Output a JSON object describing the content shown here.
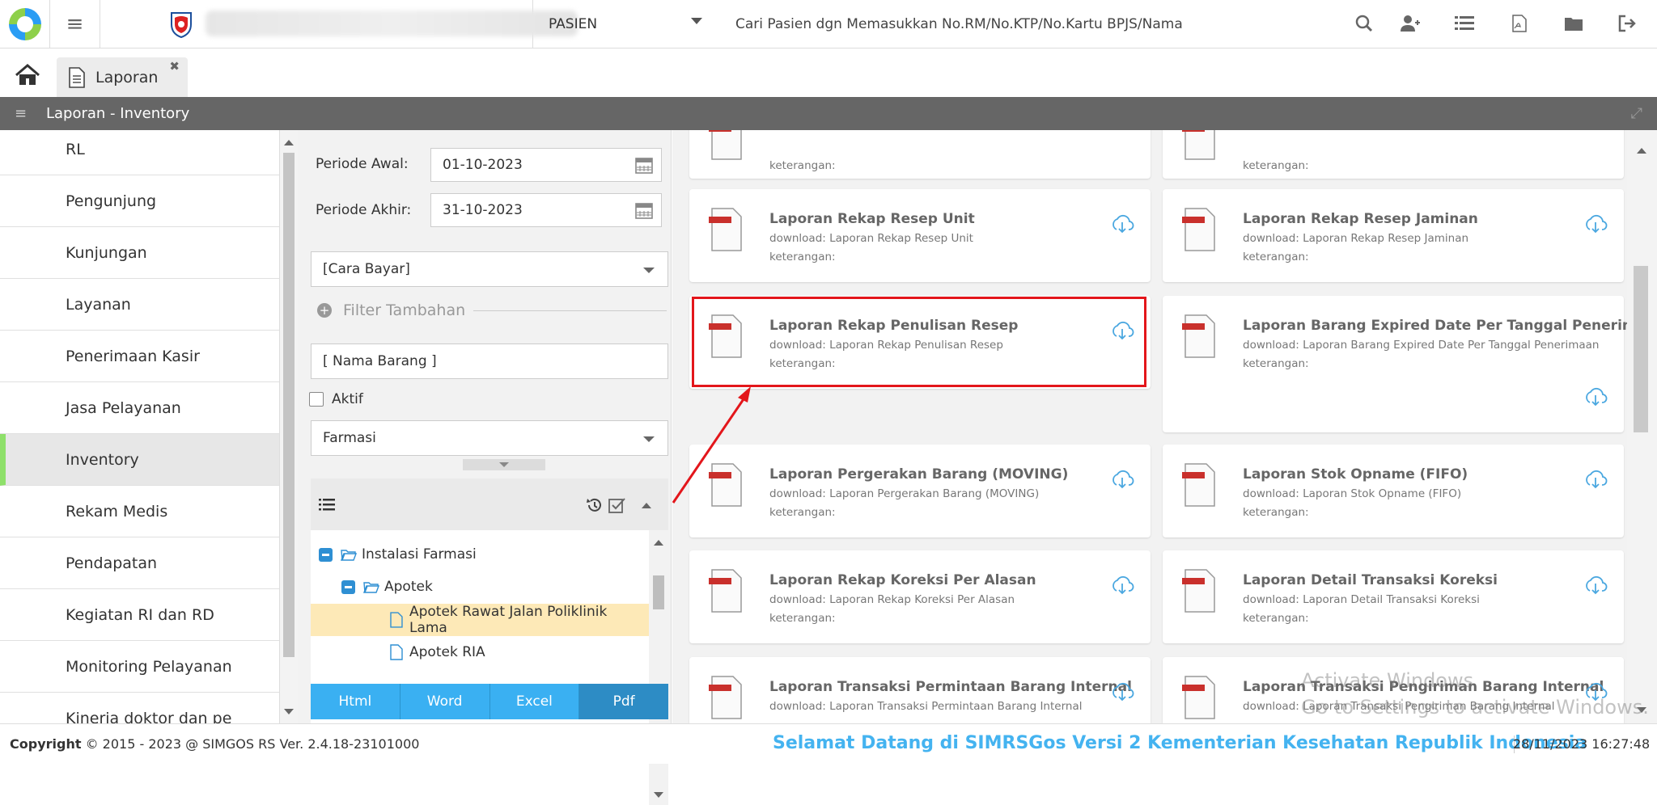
{
  "topbar": {
    "patient_type": "PASIEN",
    "search_placeholder": "Cari Pasien dgn Memasukkan No.RM/No.KTP/No.Kartu BPJS/Nama"
  },
  "tabs": [
    {
      "label": "Laporan"
    }
  ],
  "panel": {
    "title": "Laporan - Inventory"
  },
  "sidebar": {
    "items": [
      {
        "label": "RL"
      },
      {
        "label": "Pengunjung"
      },
      {
        "label": "Kunjungan"
      },
      {
        "label": "Layanan"
      },
      {
        "label": "Penerimaan Kasir"
      },
      {
        "label": "Jasa Pelayanan"
      },
      {
        "label": "Inventory",
        "active": true
      },
      {
        "label": "Rekam Medis"
      },
      {
        "label": "Pendapatan"
      },
      {
        "label": "Kegiatan RI dan RD"
      },
      {
        "label": "Monitoring Pelayanan"
      },
      {
        "label": "Kinerja doktor dan pe"
      }
    ]
  },
  "filter": {
    "periode_awal_label": "Periode Awal:",
    "periode_awal": "01-10-2023",
    "periode_akhir_label": "Periode Akhir:",
    "periode_akhir": "31-10-2023",
    "cara_bayar": "[Cara Bayar]",
    "filter_tambahan": "Filter Tambahan",
    "nama_barang_placeholder": "[ Nama Barang ]",
    "aktif_label": "Aktif",
    "unit": "Farmasi",
    "tree": [
      {
        "label": "Instalasi Farmasi"
      },
      {
        "label": "Apotek"
      },
      {
        "label": "Apotek Rawat Jalan Poliklinik Lama",
        "selected": true
      },
      {
        "label": "Apotek RIA"
      }
    ],
    "export_buttons": [
      {
        "label": "Html"
      },
      {
        "label": "Word"
      },
      {
        "label": "Excel"
      },
      {
        "label": "Pdf"
      }
    ]
  },
  "reports": [
    {
      "title": "",
      "download": "",
      "note": "keterangan:"
    },
    {
      "title": "",
      "download": "",
      "note": "keterangan:"
    },
    {
      "title": "Laporan Rekap Resep Unit",
      "download": "download: Laporan Rekap Resep Unit",
      "note": "keterangan:"
    },
    {
      "title": "Laporan Rekap Resep Jaminan",
      "download": "download: Laporan Rekap Resep Jaminan",
      "note": "keterangan:"
    },
    {
      "title": "Laporan Rekap Penulisan Resep",
      "download": "download: Laporan Rekap Penulisan Resep",
      "note": "keterangan:"
    },
    {
      "title": "Laporan Barang Expired Date Per Tanggal Penerimaan",
      "download": "download: Laporan Barang Expired Date Per Tanggal Penerimaan",
      "note": "keterangan:"
    },
    {
      "title": "Laporan Pergerakan Barang (MOVING)",
      "download": "download: Laporan Pergerakan Barang (MOVING)",
      "note": "keterangan:"
    },
    {
      "title": "Laporan Stok Opname (FIFO)",
      "download": "download: Laporan Stok Opname (FIFO)",
      "note": "keterangan:"
    },
    {
      "title": "Laporan Rekap Koreksi Per Alasan",
      "download": "download: Laporan Rekap Koreksi Per Alasan",
      "note": "keterangan:"
    },
    {
      "title": "Laporan Detail Transaksi Koreksi",
      "download": "download: Laporan Detail Transaksi Koreksi",
      "note": "keterangan:"
    },
    {
      "title": "Laporan Transaksi Permintaan Barang Internal",
      "download": "download: Laporan Transaksi Permintaan Barang Internal",
      "note": ""
    },
    {
      "title": "Laporan Transaksi Pengiriman Barang Internal",
      "download": "download: Laporan Transaksi Pengiriman Barang Internal",
      "note": ""
    }
  ],
  "watermark": {
    "line1": "Activate Windows",
    "line2": "Go to Settings to activate Windows."
  },
  "footer": {
    "copyright_label": "Copyright",
    "copyright": "2015 - 2023 @ SIMGOS RS Ver. 2.4.18-23101000",
    "welcome": "Selamat Datang di SIMRSGos Versi 2 Kementerian Kesehatan Republik Indonesia",
    "datetime": "28/11/2023 16:27:48"
  },
  "colors": {
    "accent": "#3ab0f2",
    "active_marker": "#8ee06a",
    "highlight": "#e3161b",
    "header": "#666666"
  }
}
